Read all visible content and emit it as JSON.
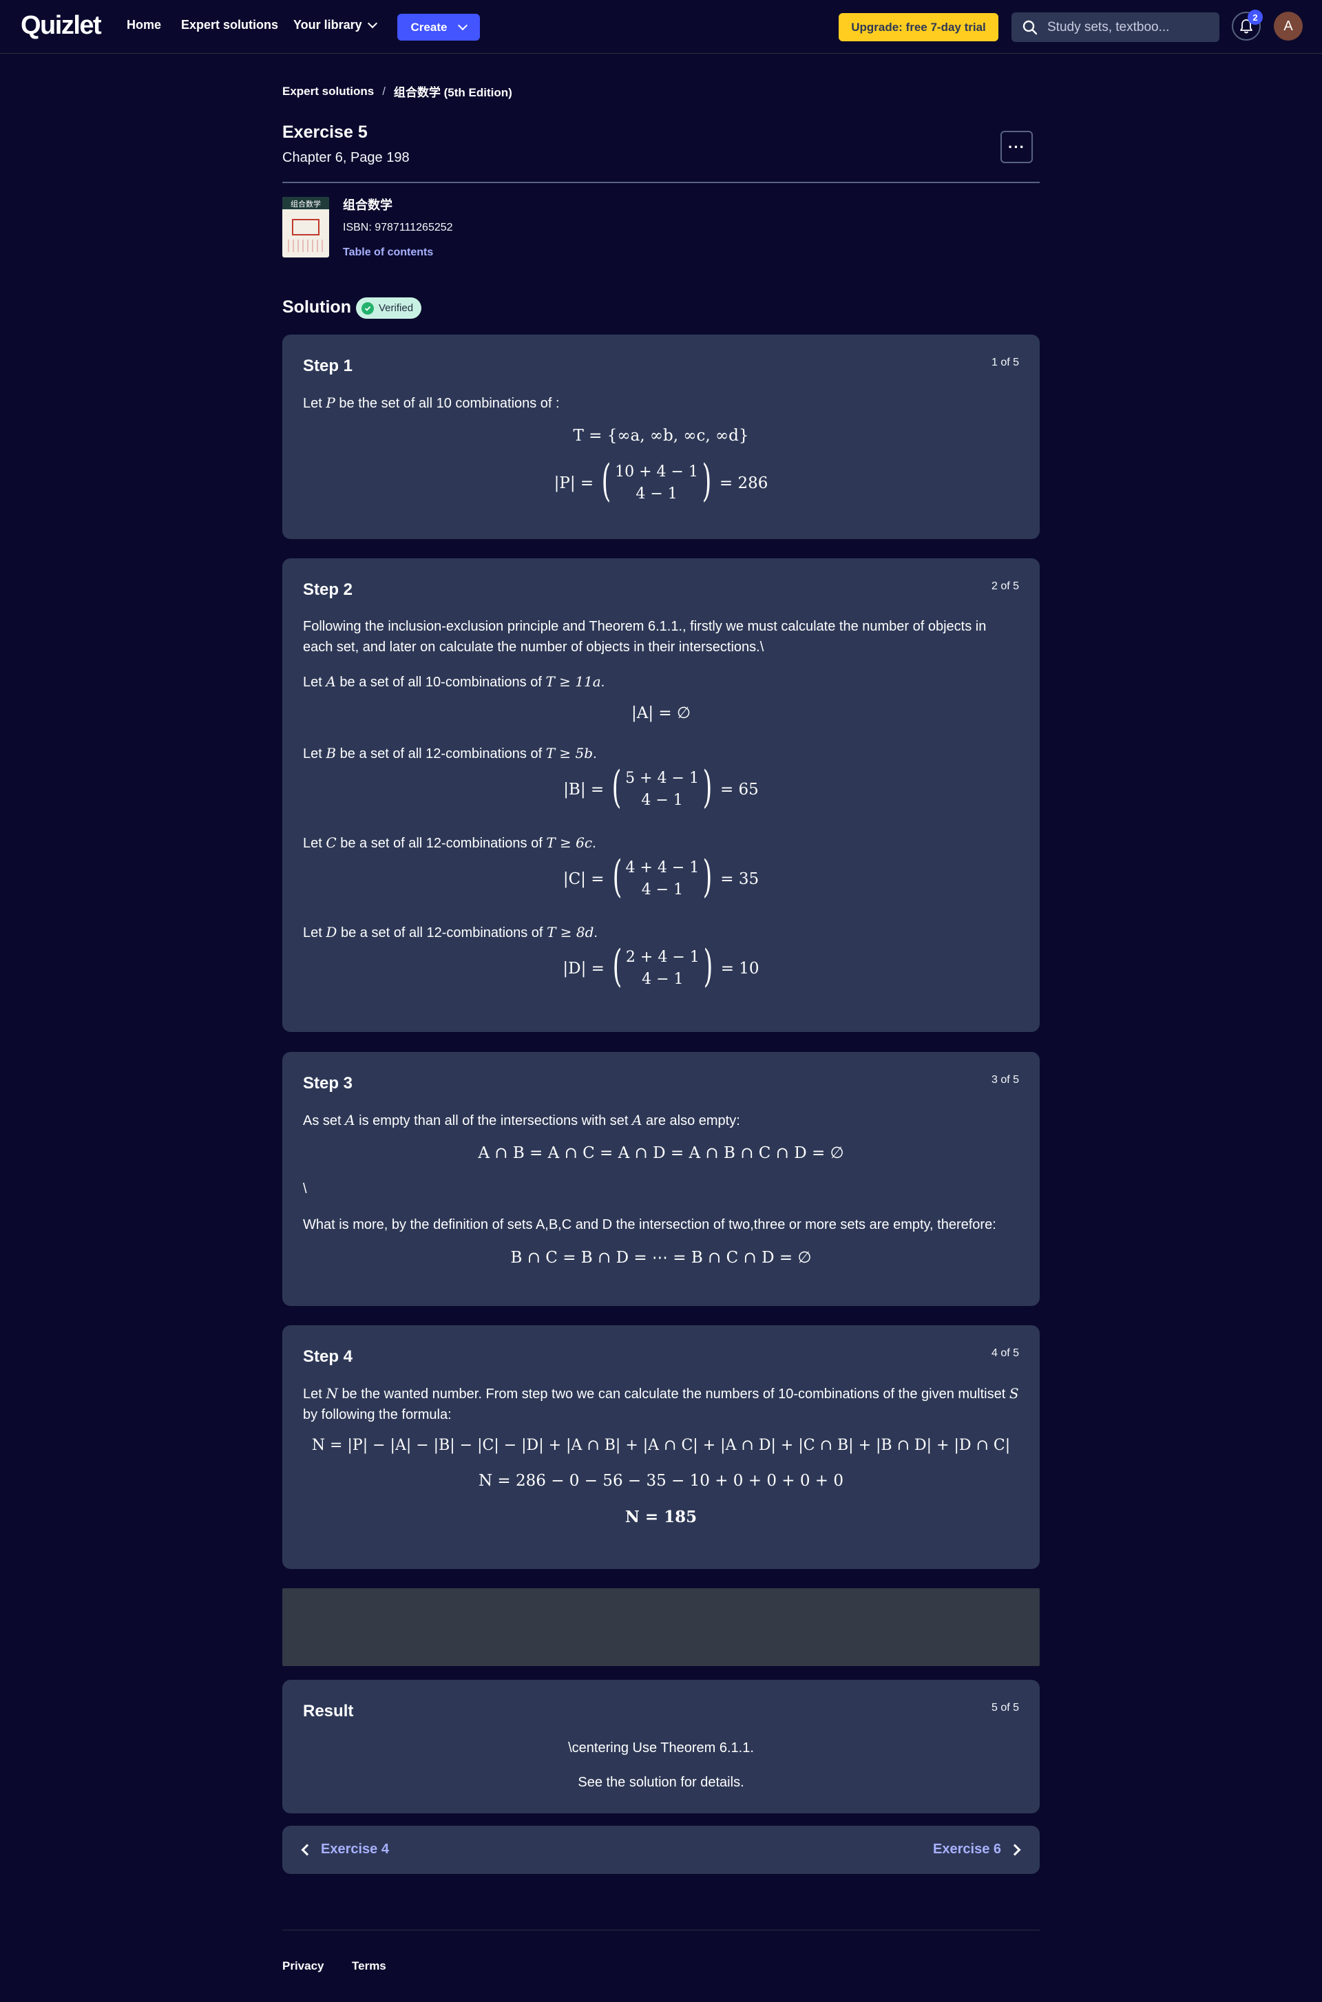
{
  "nav": {
    "logo": "Quizlet",
    "home": "Home",
    "expert_solutions": "Expert solutions",
    "your_library": "Your library",
    "create": "Create",
    "upgrade": "Upgrade: free 7-day trial",
    "search_placeholder": "Study sets, textboo...",
    "notification_count": "2",
    "avatar_initial": "A"
  },
  "breadcrumb": {
    "root": "Expert solutions",
    "separator": "/",
    "current": "组合数学 (5th Edition)"
  },
  "exercise": {
    "title": "Exercise 5",
    "subtitle": "Chapter 6, Page 198",
    "more": "···"
  },
  "book": {
    "name": "组合数学",
    "isbn": "ISBN: 9787111265252",
    "toc": "Table of contents",
    "cover_label": "组合数学"
  },
  "solution": {
    "label": "Solution",
    "verified": "Verified"
  },
  "steps": [
    {
      "title": "Step 1",
      "count": "1 of 5",
      "text": [
        "Let",
        "P",
        "be the set of all 10 combinations of :"
      ],
      "eq1": "T = {∞a, ∞b, ∞c, ∞d}",
      "eq2_left": "|P| =",
      "eq2_top": "10 + 4 − 1",
      "eq2_bottom": "4 − 1",
      "eq2_right": "= 286"
    },
    {
      "title": "Step 2",
      "count": "2 of 5",
      "intro": "Following the inclusion-exclusion principle and Theorem 6.1.1., firstly we must calculate the number of objects in each set, and later on calculate the number of objects in their intersections.\\",
      "a_pre": "Let",
      "a_var": "A",
      "a_mid": "be a set of all 10-combinations of",
      "a_cond": "T ≥ 11a",
      "a_end": ".",
      "a_eq": "|A| = ∅",
      "b_pre": "Let",
      "b_var": "B",
      "b_mid": "be a set of all 12-combinations of",
      "b_cond": "T ≥ 5b",
      "b_end": ".",
      "b_left": "|B| =",
      "b_top": "5 + 4 − 1",
      "b_bottom": "4 − 1",
      "b_right": "= 65",
      "c_pre": "Let",
      "c_var": "C",
      "c_mid": "be a set of all 12-combinations of",
      "c_cond": "T ≥ 6c",
      "c_end": ".",
      "c_left": "|C| =",
      "c_top": "4 + 4 − 1",
      "c_bottom": "4 − 1",
      "c_right": "= 35",
      "d_pre": "Let",
      "d_var": "D",
      "d_mid": "be a set of all 12-combinations of",
      "d_cond": "T ≥ 8d",
      "d_end": ".",
      "d_left": "|D| =",
      "d_top": "2 + 4 − 1",
      "d_bottom": "4 − 1",
      "d_right": "= 10"
    },
    {
      "title": "Step 3",
      "count": "3 of 5",
      "t1_pre": "As set",
      "t1_var": "A",
      "t1_mid": "is empty than all of the intersections with set",
      "t1_var2": "A",
      "t1_end": "are also empty:",
      "eq1": "A ∩ B = A ∩ C = A ∩ D = A ∩ B ∩ C ∩ D = ∅",
      "backslash": "\\",
      "t2": "What is more, by the definition of sets A,B,C and D the intersection of two,three or more sets are empty, therefore:",
      "eq2": "B ∩ C = B ∩ D = ⋯ = B ∩ C ∩ D = ∅"
    },
    {
      "title": "Step 4",
      "count": "4 of 5",
      "t_pre": "Let",
      "t_var": "N",
      "t_mid": "be the wanted number. From step two we can calculate the numbers of 10-combinations of the given multiset",
      "t_var2": "S",
      "t_end": "by following the formula:",
      "eq1": "N = |P| − |A| − |B| − |C| − |D| + |A ∩ B| + |A ∩ C| + |A ∩ D| + |C ∩ B| + |B ∩ D| + |D ∩ C|",
      "eq2": "N = 286 − 0 − 56 − 35 − 10 + 0 + 0 + 0 + 0",
      "eq3": "N = 185"
    }
  ],
  "result": {
    "title": "Result",
    "count": "5 of 5",
    "line1": "\\centering Use Theorem 6.1.1.",
    "line2": "See the solution for details."
  },
  "pager": {
    "prev": "Exercise 4",
    "next": "Exercise 6"
  },
  "footer": {
    "privacy": "Privacy",
    "terms": "Terms"
  },
  "colors": {
    "background": "#0a092d",
    "card": "#2e3856",
    "accent": "#4255ff",
    "upgrade": "#ffcd1f",
    "link": "#a8b1ff",
    "verified_bg": "#c9f1e3"
  }
}
